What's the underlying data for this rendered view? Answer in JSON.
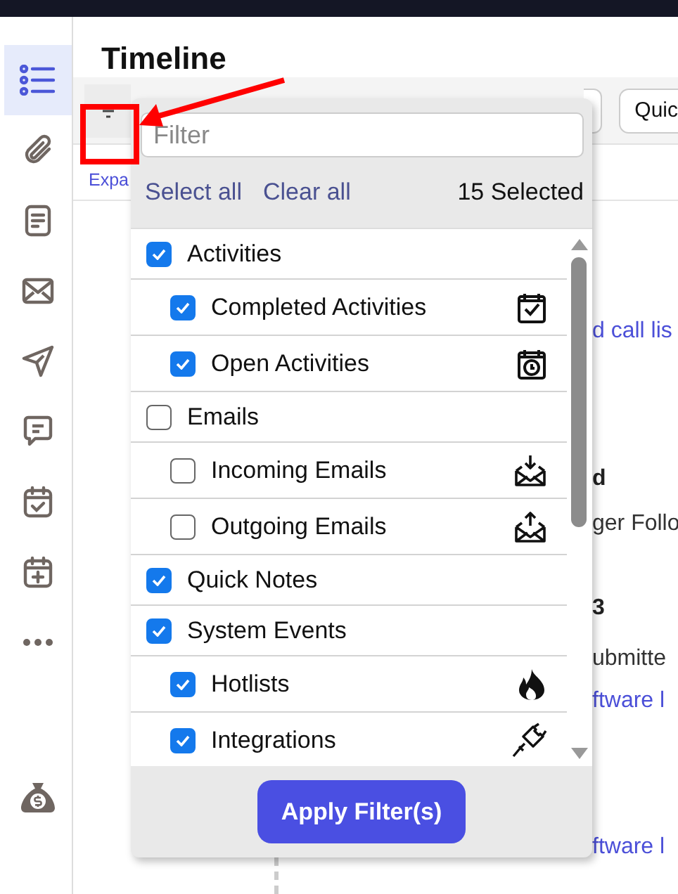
{
  "sidebar": {
    "items": [
      {
        "kind": "timeline",
        "selected": true
      },
      {
        "kind": "attachment",
        "selected": false
      },
      {
        "kind": "document",
        "selected": false
      },
      {
        "kind": "envelope",
        "selected": false
      },
      {
        "kind": "send",
        "selected": false
      },
      {
        "kind": "chat",
        "selected": false
      },
      {
        "kind": "calendar-check",
        "selected": false
      },
      {
        "kind": "calendar-plus",
        "selected": false
      },
      {
        "kind": "more",
        "selected": false
      },
      {
        "kind": "money",
        "selected": false
      }
    ]
  },
  "page": {
    "title": "Timeline"
  },
  "toolbar": {
    "quick_button": "Quic",
    "expand_link": "Expa"
  },
  "background_fragments": [
    {
      "text": "d call lis",
      "kind": "link"
    },
    {
      "text": "d",
      "kind": "heading"
    },
    {
      "text": "ger Follo",
      "kind": "plain"
    },
    {
      "text": "3",
      "kind": "heading"
    },
    {
      "text": "ubmitte",
      "kind": "plain"
    },
    {
      "text": "ftware l",
      "kind": "link"
    },
    {
      "text": "ftware l",
      "kind": "link"
    }
  ],
  "filter_popup": {
    "search": {
      "placeholder": "Filter"
    },
    "select_all": "Select all",
    "clear_all": "Clear all",
    "selected_count": "15 Selected",
    "options": [
      {
        "label": "Activities",
        "checked": true,
        "children": [
          {
            "label": "Completed Activities",
            "checked": true,
            "kind": "calendar-check"
          },
          {
            "label": "Open Activities",
            "checked": true,
            "kind": "calendar-clock"
          }
        ]
      },
      {
        "label": "Emails",
        "checked": false,
        "children": [
          {
            "label": "Incoming Emails",
            "checked": false,
            "kind": "mail-in"
          },
          {
            "label": "Outgoing Emails",
            "checked": false,
            "kind": "mail-out"
          }
        ]
      },
      {
        "label": "Quick Notes",
        "checked": true
      },
      {
        "label": "System Events",
        "checked": true,
        "children": [
          {
            "label": "Hotlists",
            "checked": true,
            "kind": "flame"
          },
          {
            "label": "Integrations",
            "checked": true,
            "kind": "plug"
          }
        ]
      }
    ],
    "apply_button": "Apply Filter(s)"
  }
}
